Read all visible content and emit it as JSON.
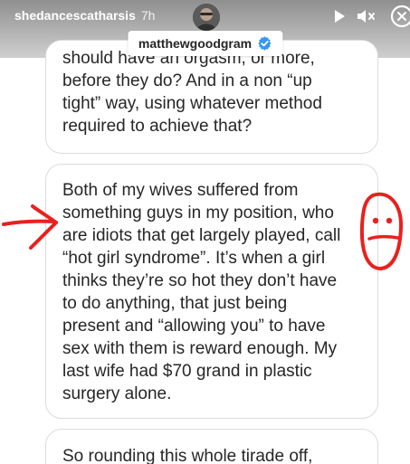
{
  "story_header": {
    "username": "shedancescatharsis",
    "time_ago": "7h",
    "icons": [
      "avatar",
      "play-icon",
      "mute-icon",
      "close-icon"
    ]
  },
  "mention_sticker": {
    "handle": "matthewgoodgram",
    "icon": "verified-badge-icon"
  },
  "messages": [
    {
      "text": "should have an orgasm, or more,\nbefore they do? And in a non “up\ntight” way, using whatever method\nrequired to achieve that?"
    },
    {
      "text": "Both of my wives suffered from\nsomething guys in my position, who\nare idiots that get largely played, call\n“hot girl syndrome”. It’s when a girl\nthinks they’re so hot they don’t have\nto do anything, that just being\npresent and “allowing you” to have\nsex with them is reward enough. My\nlast wife had $70 grand in plastic\nsurgery alone."
    },
    {
      "text": "So rounding this whole tirade off,"
    }
  ],
  "annotations": {
    "arrow": {
      "color": "#e8211f",
      "meaning": "points-at-message"
    },
    "face": {
      "color": "#e8211f",
      "meaning": "unimpressed-face-drawing"
    }
  },
  "colors": {
    "accent_verified": "#3897f0",
    "text": "#262626",
    "bubble_border": "#dcdcdc"
  }
}
